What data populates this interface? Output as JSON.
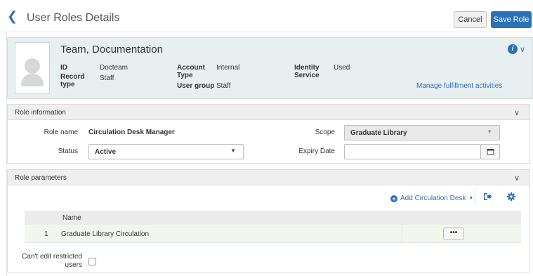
{
  "header": {
    "title": "User Roles Details",
    "cancel_label": "Cancel",
    "save_label": "Save Role"
  },
  "user": {
    "name": "Team, Documentation",
    "id_label": "ID",
    "id_value": "Docteam",
    "record_type_label": "Record type",
    "record_type_value": "Staff",
    "account_type_label": "Account Type",
    "account_type_value": "Internal",
    "user_group_label": "User group",
    "user_group_value": "Staff",
    "identity_service_label": "Identity Service",
    "identity_service_value": "Used",
    "manage_link": "Manage fulfillment activities"
  },
  "role_info": {
    "title": "Role information",
    "role_name_label": "Role name",
    "role_name_value": "Circulation Desk Manager",
    "status_label": "Status",
    "status_value": "Active",
    "scope_label": "Scope",
    "scope_value": "Graduate Library",
    "expiry_label": "Expiry Date",
    "expiry_value": ""
  },
  "role_params": {
    "title": "Role parameters",
    "add_desk_label": "Add Circulation Desk",
    "column_name": "Name",
    "rows": [
      {
        "num": "1",
        "name": "Graduate Library Circulation",
        "action": "•••"
      }
    ],
    "cant_edit_label": "Can't edit restricted users"
  },
  "colors": {
    "accent": "#2a71b8",
    "card_bg": "#e8eff0",
    "row_bg": "#f2f7ee"
  }
}
